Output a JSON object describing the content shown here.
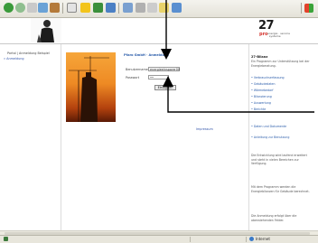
{
  "logo": {
    "number": "27",
    "pro": "pro",
    "sub": "energie · service · systeme"
  },
  "sidebar": {
    "title": "Portal | Anmeldung Beispiel",
    "link": "» Anmeldung"
  },
  "form": {
    "title": "Pfaro GmbH · Anmeldung",
    "username_label": "Benutzername",
    "username_value": "energieeinsparer00",
    "password_label": "Passwort",
    "password_value": "••",
    "login_button": "Einloggen"
  },
  "footer": {
    "impressum": "Impressum"
  },
  "right_column": {
    "title": "27-Bilanz",
    "intro": "Ein Programm zur Unterstützung bei der Energieberatung.",
    "bullets": [
      "• Verbrauchserfassung",
      "• Gebäudedaten",
      "• Wärmebedarf",
      "• Bilanzierung",
      "• Auswertung",
      "• Berichte"
    ],
    "lower_bullets": [
      "• Daten und Dokumente",
      "• Anleitung zur Benutzung"
    ],
    "paragraph_1": "Die Entwicklung wird laufend erweitert und steht in vielen Bereichen zur Verfügung.",
    "paragraph_2": "Mit dem Programm werden die Energiebilanzen für Gebäude berechnet.",
    "paragraph_3": "Die Anmeldung erfolgt über die obenstehenden Felder."
  },
  "status_bar": {
    "zone": "Internet"
  },
  "colors": {
    "link": "#2a5caa",
    "accent": "#d4322c",
    "toolbar": "#e4e2d8"
  }
}
